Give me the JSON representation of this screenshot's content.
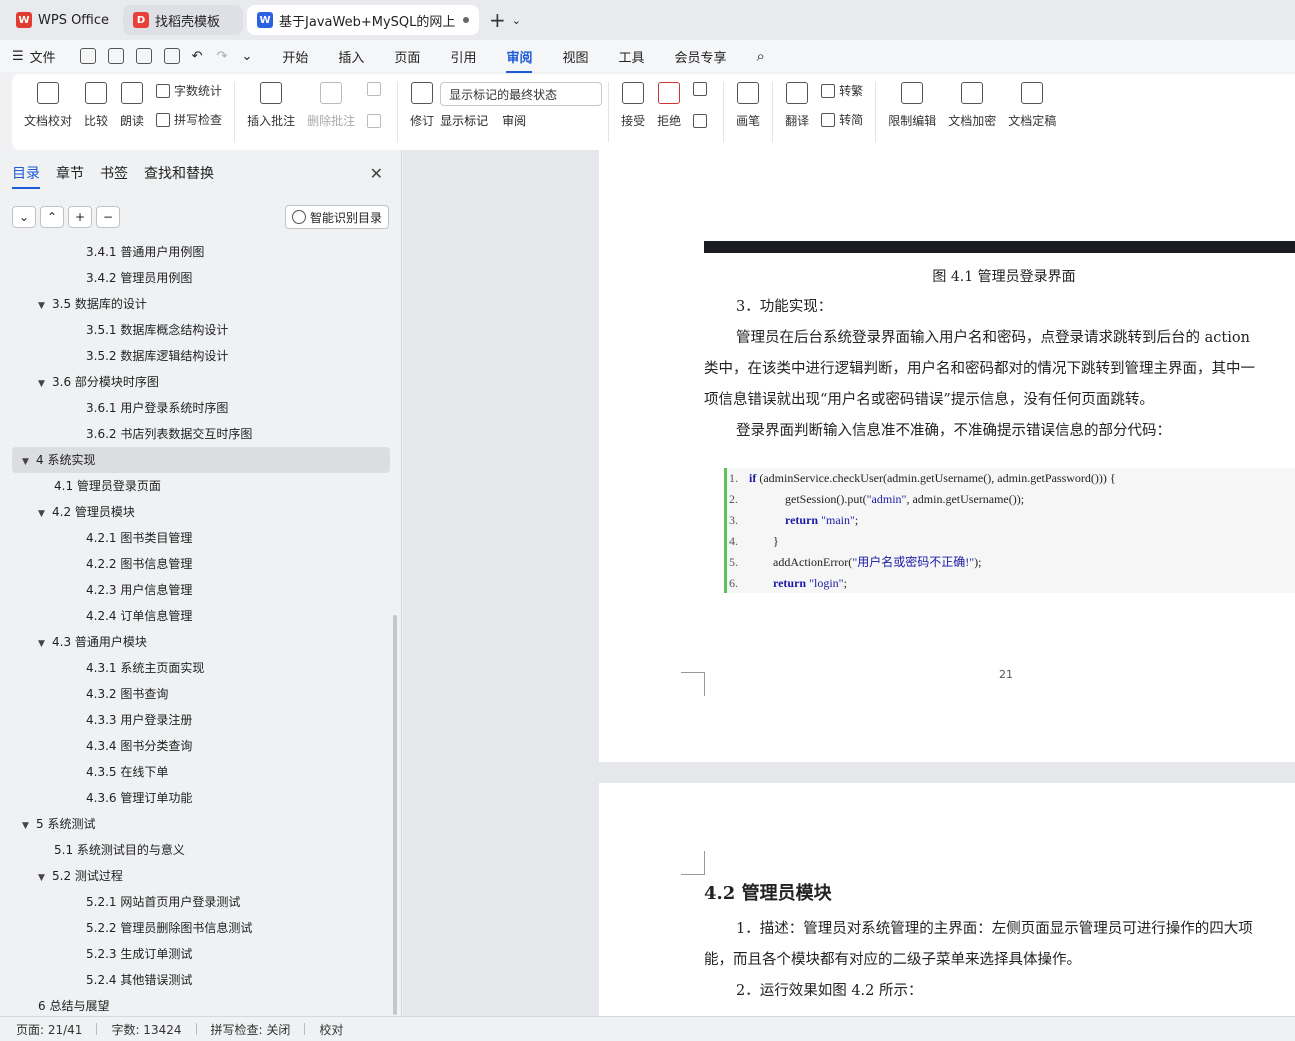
{
  "tabs": [
    {
      "label": "WPS Office",
      "logo": "W",
      "color": "#e03c31"
    },
    {
      "label": "找稻壳模板",
      "logo": "D",
      "color": "#e8413c"
    },
    {
      "label": "基于JavaWeb+MySQL的网上",
      "logo": "W",
      "color": "#2b62e3"
    }
  ],
  "menubar": {
    "file": "文件",
    "items": [
      "开始",
      "插入",
      "页面",
      "引用",
      "审阅",
      "视图",
      "工具",
      "会员专享"
    ],
    "active": "审阅"
  },
  "ribbon": {
    "doc_check": "文档校对",
    "compare": "比较",
    "read": "朗读",
    "word_count": "字数统计",
    "spell_check": "拼写检查",
    "insert_comment": "插入批注",
    "delete_comment": "删除批注",
    "revise": "修订",
    "markup_state": "显示标记的最终状态",
    "show_markup": "显示标记",
    "review": "审阅",
    "accept": "接受",
    "reject": "拒绝",
    "ink": "画笔",
    "translate": "翻译",
    "to_traditional": "转繁",
    "to_simplified": "转简",
    "restrict_edit": "限制编辑",
    "encrypt": "文档加密",
    "finalize": "文档定稿"
  },
  "sidebar": {
    "tabs": [
      "目录",
      "章节",
      "书签",
      "查找和替换"
    ],
    "smart_toc": "智能识别目录",
    "toc": [
      {
        "text": "3.4.1  普通用户用例图",
        "level": 3
      },
      {
        "text": "3.4.2  管理员用例图",
        "level": 3
      },
      {
        "text": "3.5  数据库的设计",
        "level": 2,
        "arrow": true
      },
      {
        "text": "3.5.1  数据库概念结构设计",
        "level": 3
      },
      {
        "text": "3.5.2  数据库逻辑结构设计",
        "level": 3
      },
      {
        "text": "3.6  部分模块时序图",
        "level": 2,
        "arrow": true
      },
      {
        "text": "3.6.1  用户登录系统时序图",
        "level": 3
      },
      {
        "text": "3.6.2  书店列表数据交互时序图",
        "level": 3
      },
      {
        "text": "4  系统实现",
        "level": 1,
        "arrow": true,
        "selected": true
      },
      {
        "text": "4.1  管理员登录页面",
        "level": 2
      },
      {
        "text": "4.2  管理员模块",
        "level": 2,
        "arrow": true
      },
      {
        "text": "4.2.1  图书类目管理",
        "level": 3
      },
      {
        "text": "4.2.2  图书信息管理",
        "level": 3
      },
      {
        "text": "4.2.3  用户信息管理",
        "level": 3
      },
      {
        "text": "4.2.4  订单信息管理",
        "level": 3
      },
      {
        "text": "4.3  普通用户模块",
        "level": 2,
        "arrow": true
      },
      {
        "text": "4.3.1  系统主页面实现",
        "level": 3
      },
      {
        "text": "4.3.2  图书查询",
        "level": 3
      },
      {
        "text": "4.3.3  用户登录注册",
        "level": 3
      },
      {
        "text": "4.3.4  图书分类查询",
        "level": 3
      },
      {
        "text": "4.3.5  在线下单",
        "level": 3
      },
      {
        "text": "4.3.6  管理订单功能",
        "level": 3
      },
      {
        "text": "5  系统测试",
        "level": 1,
        "arrow": true
      },
      {
        "text": "5.1  系统测试目的与意义",
        "level": 2
      },
      {
        "text": "5.2  测试过程",
        "level": 2,
        "arrow": true
      },
      {
        "text": "5.2.1  网站首页用户登录测试",
        "level": 3
      },
      {
        "text": "5.2.2  管理员删除图书信息测试",
        "level": 3
      },
      {
        "text": "5.2.3  生成订单测试",
        "level": 3
      },
      {
        "text": "5.2.4  其他错误测试",
        "level": 3
      },
      {
        "text": "6  总结与展望",
        "level": 1
      }
    ]
  },
  "doc": {
    "caption": "图 4.1 管理员登录界面",
    "p1": "3．功能实现：",
    "p2": "管理员在后台系统登录界面输入用户名和密码，点登录请求跳转到后台的 action",
    "p3": "类中，在该类中进行逻辑判断，用户名和密码都对的情况下跳转到管理主界面，其中一",
    "p4": "项信息错误就出现“用户名或密码错误”提示信息，没有任何页面跳转。",
    "p5": "登录界面判断输入信息准不准确，不准确提示错误信息的部分代码：",
    "page_number": "21",
    "heading": "4.2  管理员模块",
    "q1": "1．描述：管理员对系统管理的主界面：左侧页面显示管理员可进行操作的四大项",
    "q2": "能，而且各个模块都有对应的二级子菜单来选择具体操作。",
    "q3": "2．运行效果如图 4.2 所示："
  },
  "status": {
    "page": "页面: 21/41",
    "words": "字数: 13424",
    "spell": "拼写检查: 关闭",
    "proof": "校对"
  }
}
